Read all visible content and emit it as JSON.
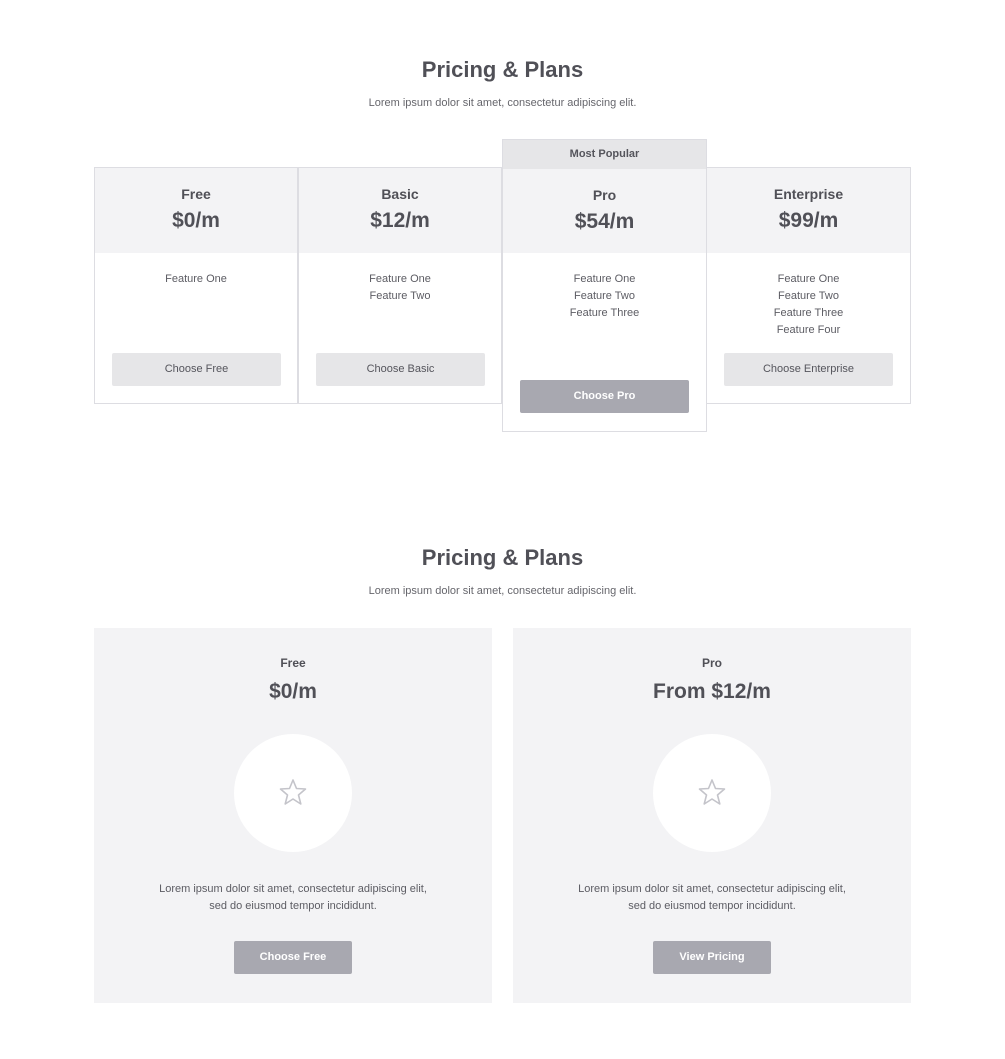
{
  "section1": {
    "title": "Pricing & Plans",
    "subtitle": "Lorem ipsum dolor sit amet, consectetur adipiscing elit.",
    "popular_label": "Most Popular",
    "plans": [
      {
        "name": "Free",
        "price": "$0/m",
        "features": [
          "Feature One"
        ],
        "button": "Choose Free"
      },
      {
        "name": "Basic",
        "price": "$12/m",
        "features": [
          "Feature One",
          "Feature Two"
        ],
        "button": "Choose Basic"
      },
      {
        "name": "Pro",
        "price": "$54/m",
        "features": [
          "Feature One",
          "Feature Two",
          "Feature Three"
        ],
        "button": "Choose Pro"
      },
      {
        "name": "Enterprise",
        "price": "$99/m",
        "features": [
          "Feature One",
          "Feature Two",
          "Feature Three",
          "Feature Four"
        ],
        "button": "Choose Enterprise"
      }
    ]
  },
  "section2": {
    "title": "Pricing & Plans",
    "subtitle": "Lorem ipsum dolor sit amet, consectetur adipiscing elit.",
    "cards": [
      {
        "name": "Free",
        "price": "$0/m",
        "icon": "star-icon",
        "description_line1": "Lorem ipsum dolor sit amet, consectetur adipiscing elit,",
        "description_line2": "sed do eiusmod tempor incididunt.",
        "button": "Choose Free"
      },
      {
        "name": "Pro",
        "price": "From $12/m",
        "icon": "star-icon",
        "description_line1": "Lorem ipsum dolor sit amet, consectetur adipiscing elit,",
        "description_line2": "sed do eiusmod tempor incididunt.",
        "button": "View Pricing"
      }
    ]
  },
  "colors": {
    "header_bg": "#f3f3f5",
    "button_gray": "#e6e6e8",
    "button_accent": "#a8a8b0",
    "text": "#505057"
  }
}
